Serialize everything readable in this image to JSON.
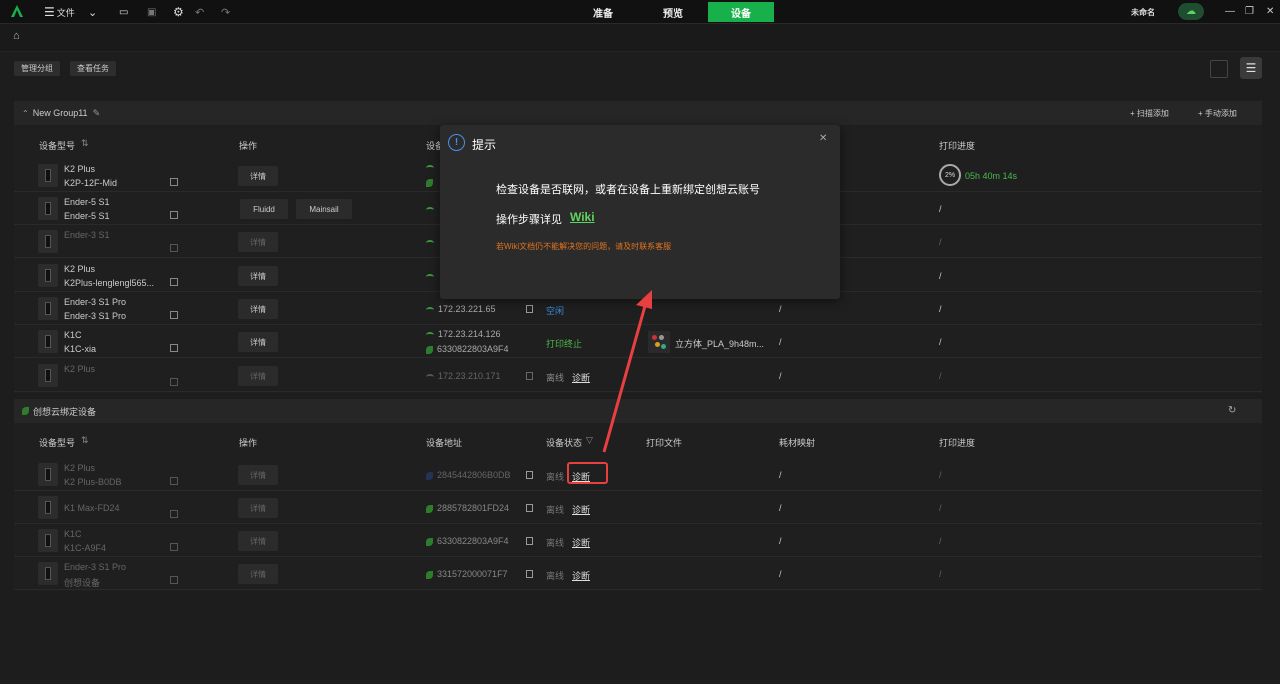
{
  "topbar": {
    "file_menu": "文件",
    "tabs": [
      "准备",
      "预览",
      "设备"
    ],
    "active_tab": "设备",
    "project_name": "未命名"
  },
  "toolbar": {
    "manage_group": "管理分组",
    "view_tasks": "查看任务"
  },
  "group1": {
    "name": "New Group11",
    "scan_add": "+ 扫描添加",
    "manual_add": "+ 手动添加",
    "columns": {
      "model": "设备型号",
      "op": "操作",
      "address": "设备",
      "progress": "打印进度"
    },
    "rows": [
      {
        "name": "K2 Plus",
        "sub": "K2P-12F-Mid",
        "op": "详情",
        "ip": "",
        "progress": "2%",
        "time": "05h 40m 14s"
      },
      {
        "name": "Ender-5 S1",
        "sub": "Ender-5 S1",
        "op1": "Fluidd",
        "op2": "Mainsail",
        "progress": "/"
      },
      {
        "name": "Ender-3 S1",
        "sub": "",
        "op": "详情",
        "progress": "/"
      },
      {
        "name": "K2 Plus",
        "sub": "K2Plus-lenglengl565...",
        "op": "详情",
        "progress": "/"
      },
      {
        "name": "Ender-3 S1 Pro",
        "sub": "Ender-3 S1 Pro",
        "op": "详情",
        "ip": "172.23.221.65",
        "status": "空闲",
        "filament": "/",
        "progress": "/"
      },
      {
        "name": "K1C",
        "sub": "K1C-xia",
        "op": "详情",
        "ip": "172.23.214.126",
        "cloud": "6330822803A9F4",
        "status": "打印终止",
        "file": "立方体_PLA_9h48m...",
        "filament": "/",
        "progress": "/"
      },
      {
        "name": "K2 Plus",
        "sub": "",
        "op": "详情",
        "ip": "172.23.210.171",
        "status": "离线",
        "diag": "诊断",
        "filament": "/",
        "progress": "/"
      }
    ]
  },
  "group2": {
    "name": "创想云绑定设备",
    "columns": {
      "model": "设备型号",
      "op": "操作",
      "address": "设备地址",
      "status": "设备状态",
      "file": "打印文件",
      "filament": "耗材映射",
      "progress": "打印进度"
    },
    "rows": [
      {
        "name": "K2 Plus",
        "sub": "K2 Plus-B0DB",
        "op": "详情",
        "cloud": "2845442806B0DB",
        "status": "离线",
        "diag": "诊断",
        "filament": "/",
        "progress": "/"
      },
      {
        "name": "",
        "sub": "K1 Max-FD24",
        "op": "详情",
        "cloud": "2885782801FD24",
        "status": "离线",
        "diag": "诊断",
        "filament": "/",
        "progress": "/"
      },
      {
        "name": "K1C",
        "sub": "K1C-A9F4",
        "op": "详情",
        "cloud": "6330822803A9F4",
        "status": "离线",
        "diag": "诊断",
        "filament": "/",
        "progress": "/"
      },
      {
        "name": "Ender-3 S1 Pro",
        "sub": "创想设备",
        "op": "详情",
        "cloud": "331572000071F7",
        "status": "离线",
        "diag": "诊断",
        "filament": "/",
        "progress": "/"
      }
    ]
  },
  "dialog": {
    "title": "提示",
    "line1": "检查设备是否联网，或者在设备上重新绑定创想云账号",
    "line2_prefix": "操作步骤详见",
    "wiki": "Wiki",
    "note": "若Wiki文档仍不能解决您的问题，请及时联系客服"
  },
  "colors": {
    "accent": "#17b04b",
    "link": "#5fd35f",
    "warn": "#e0731f",
    "annotation": "#e84040"
  }
}
